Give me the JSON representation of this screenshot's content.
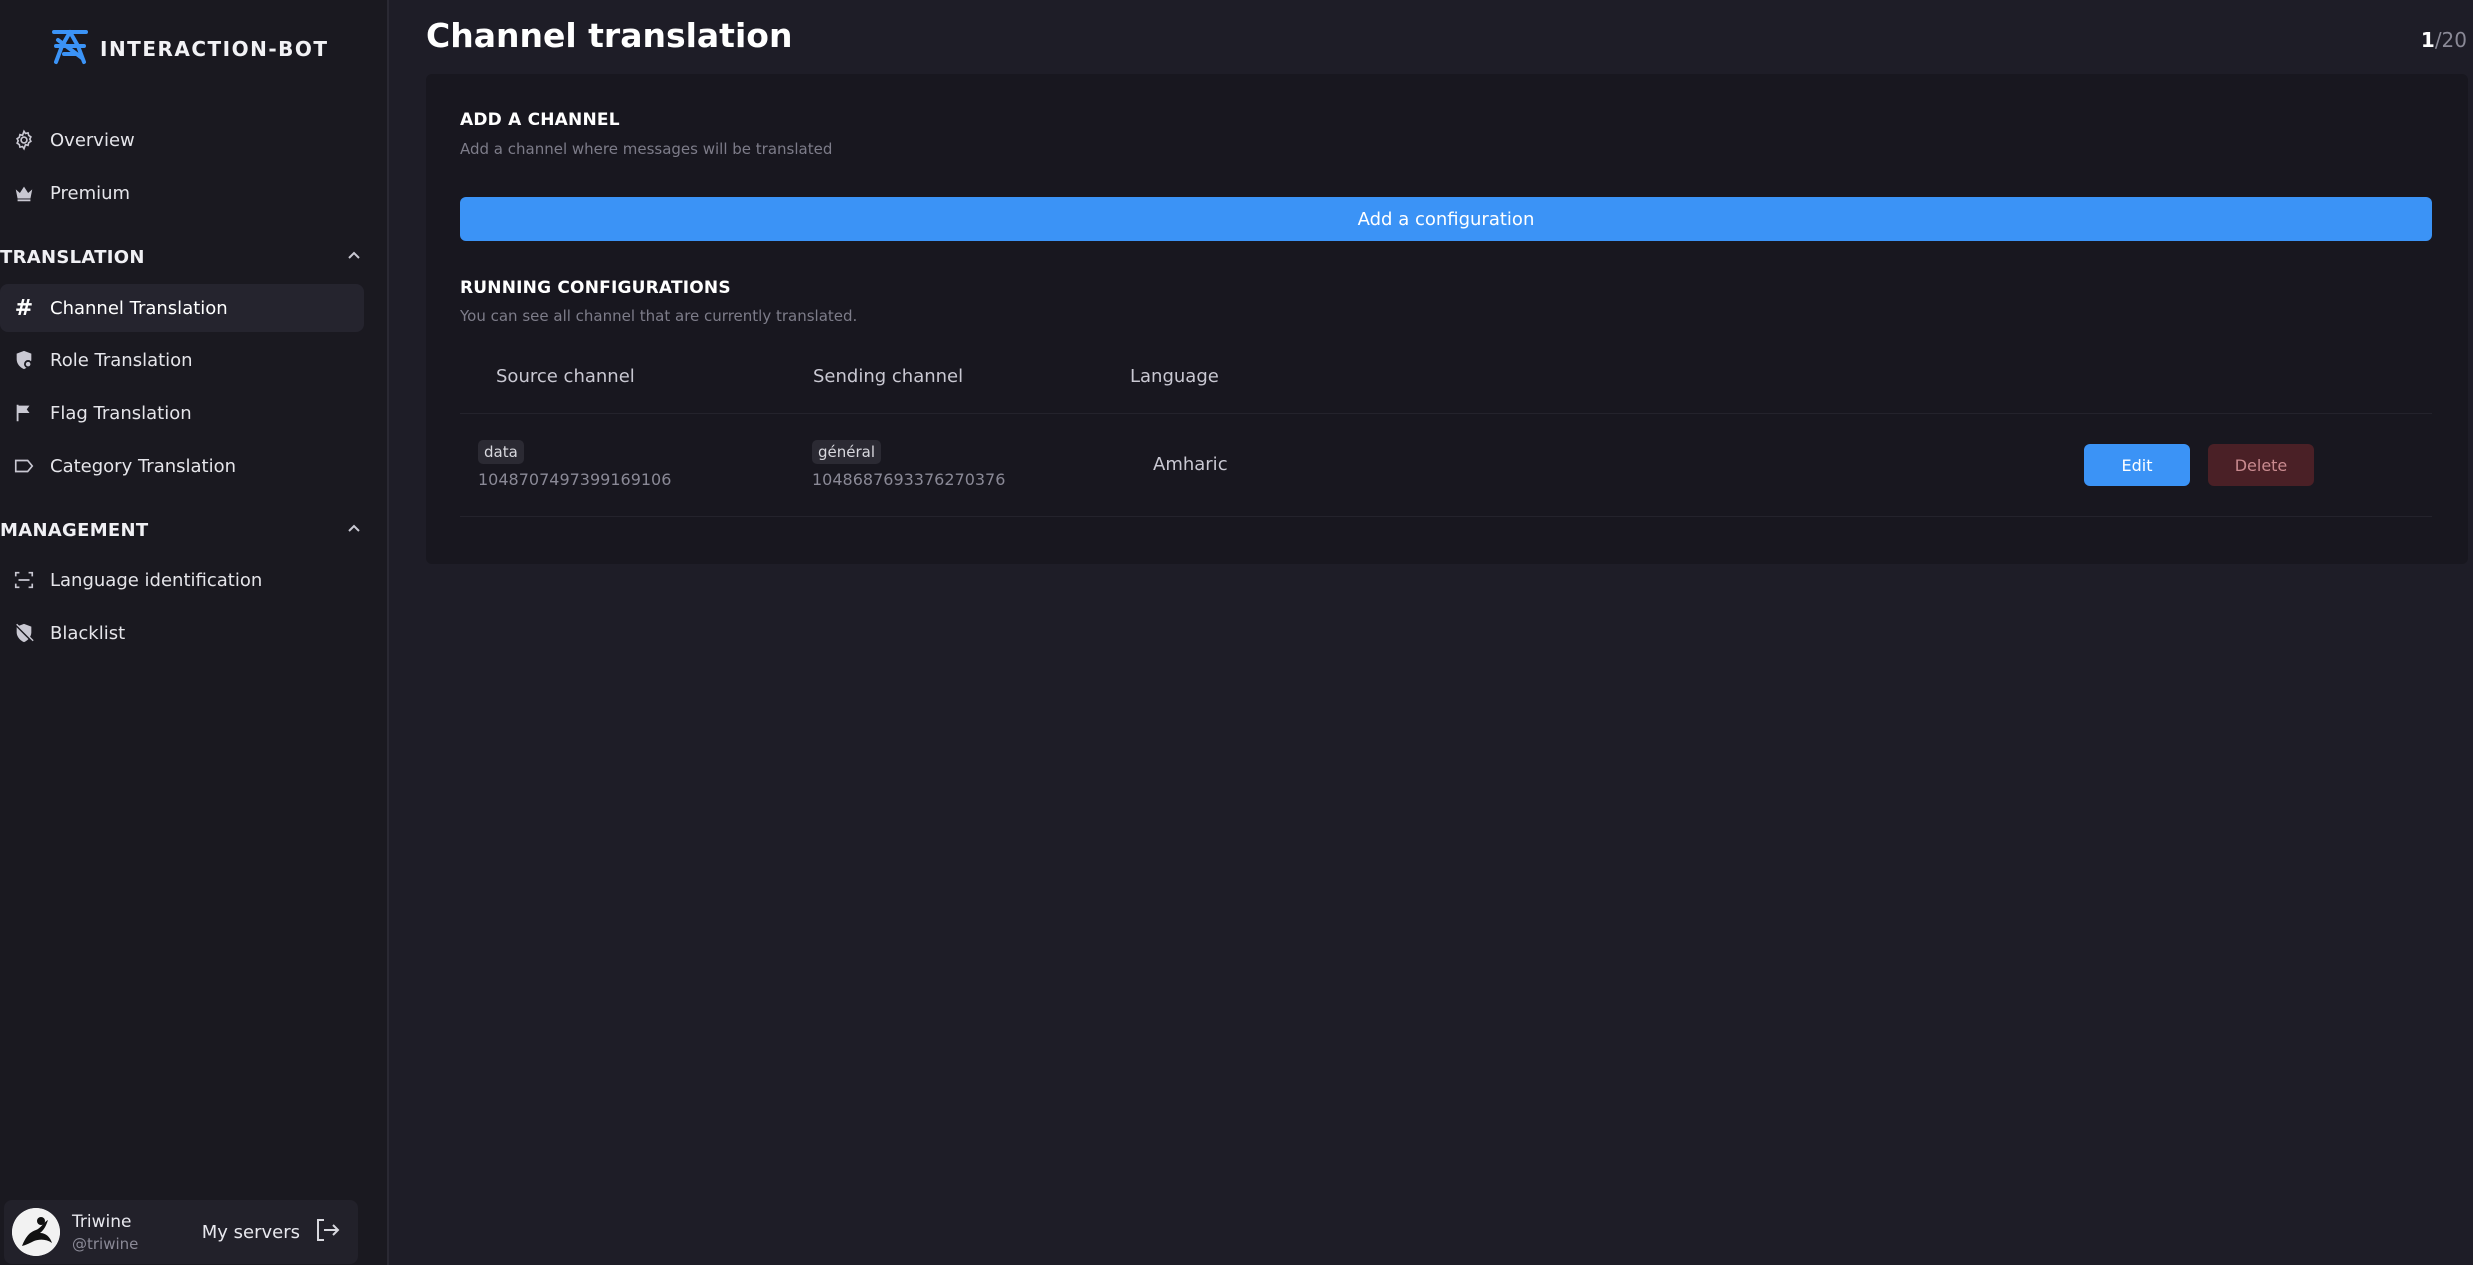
{
  "app": {
    "name": "INTERACTION-BOT",
    "accent_color": "#3b93f6",
    "danger_color": "#4a2026"
  },
  "sidebar": {
    "top_items": [
      {
        "label": "Overview",
        "icon": "gear-icon"
      },
      {
        "label": "Premium",
        "icon": "crown-icon"
      }
    ],
    "sections": [
      {
        "title": "TRANSLATION",
        "expanded": true,
        "items": [
          {
            "label": "Channel Translation",
            "icon": "hash-icon",
            "active": true
          },
          {
            "label": "Role Translation",
            "icon": "shield-gear-icon"
          },
          {
            "label": "Flag Translation",
            "icon": "flag-icon"
          },
          {
            "label": "Category Translation",
            "icon": "tag-icon"
          }
        ]
      },
      {
        "title": "MANAGEMENT",
        "expanded": true,
        "items": [
          {
            "label": "Language identification",
            "icon": "scan-icon"
          },
          {
            "label": "Blacklist",
            "icon": "shield-off-icon"
          }
        ]
      }
    ],
    "user": {
      "name": "Triwine",
      "handle": "@triwine",
      "servers_label": "My servers"
    }
  },
  "main": {
    "title": "Channel translation",
    "counter": {
      "current": "1",
      "total": "/20"
    },
    "add_section": {
      "title": "ADD A CHANNEL",
      "subtitle": "Add a channel where messages will be translated",
      "button_label": "Add a configuration"
    },
    "running_section": {
      "title": "RUNNING CONFIGURATIONS",
      "subtitle": "You can see all channel that are currently translated.",
      "columns": [
        "Source channel",
        "Sending channel",
        "Language"
      ],
      "rows": [
        {
          "source_name": "data",
          "source_id": "1048707497399169106",
          "sending_name": "général",
          "sending_id": "1048687693376270376",
          "language": "Amharic",
          "edit_label": "Edit",
          "delete_label": "Delete"
        }
      ]
    }
  }
}
